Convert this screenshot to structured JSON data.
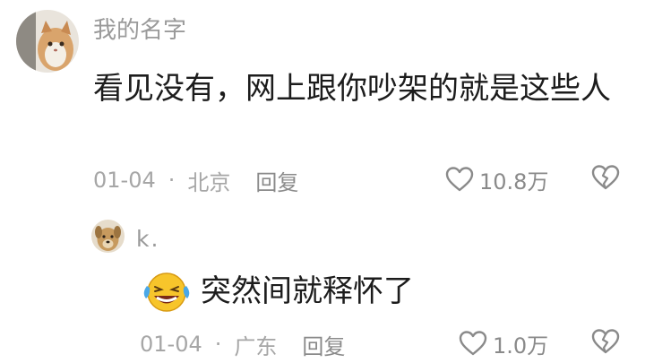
{
  "comments": [
    {
      "username": "我的名字",
      "text": "看见没有，网上跟你吵架的就是这些人",
      "date": "01-04",
      "separator": "·",
      "location": "北京",
      "reply_label": "回复",
      "likes": "10.8万",
      "avatar_icon": "cat-avatar",
      "like_icon": "heart-outline-icon",
      "dislike_icon": "broken-heart-icon"
    },
    {
      "username": "k.",
      "emoji": "😂",
      "emoji_icon": "laughing-crying-emoji-icon",
      "text": "突然间就释怀了",
      "date": "01-04",
      "separator": "·",
      "location": "广东",
      "reply_label": "回复",
      "likes": "1.0万",
      "avatar_icon": "dog-avatar",
      "like_icon": "heart-outline-icon",
      "dislike_icon": "broken-heart-icon"
    }
  ],
  "colors": {
    "background": "#ffffff",
    "meta_text": "#a6a6a6",
    "username_text": "#9a9a9a",
    "body_text": "#1c1c1c"
  }
}
